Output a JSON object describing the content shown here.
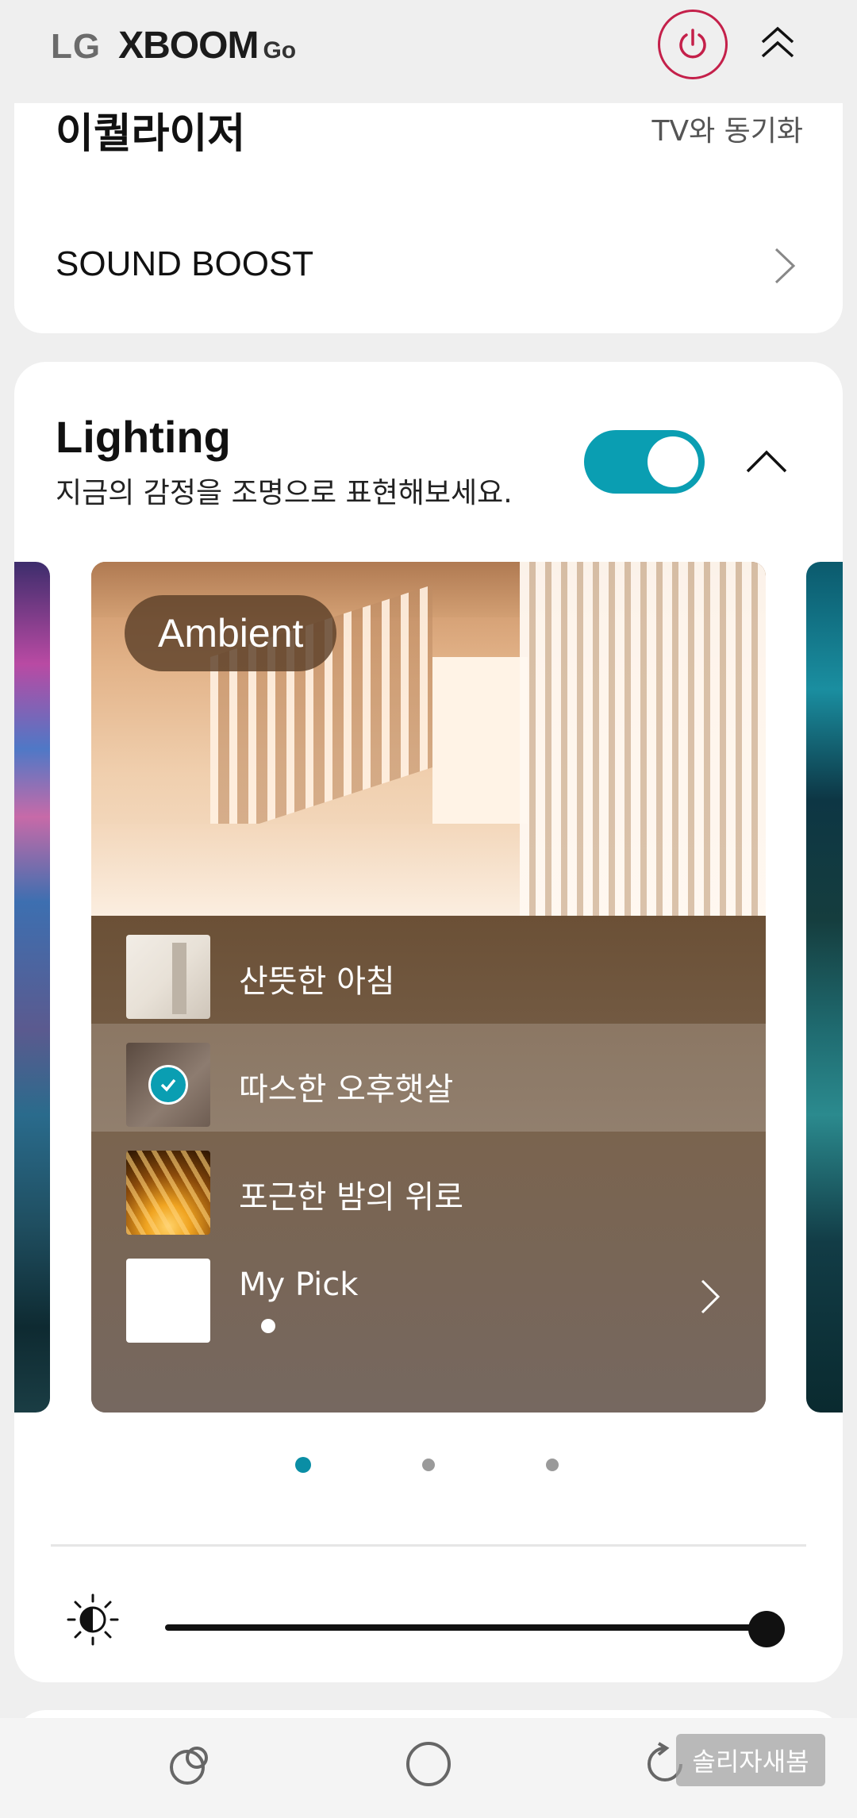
{
  "header": {
    "brand_lg": "LG",
    "brand_xboom": "XBOOM",
    "brand_go": "Go",
    "power_icon": "power-icon",
    "collapse_icon": "double-chevron-up-icon",
    "accent_color": "#c4204a"
  },
  "equalizer": {
    "title": "이퀄라이저",
    "tv_sync": "TV와 동기화",
    "sound_boost_label": "SOUND BOOST"
  },
  "lighting": {
    "title": "Lighting",
    "subtitle": "지금의 감정을 조명으로 표현해보세요.",
    "toggle_on": true,
    "toggle_color": "#0a9eb2",
    "mode_name": "Ambient",
    "items": [
      {
        "label": "산뜻한 아침",
        "selected": false
      },
      {
        "label": "따스한 오후햇살",
        "selected": true
      },
      {
        "label": "포근한 밤의 위로",
        "selected": false
      },
      {
        "label": "My Pick",
        "selected": false
      }
    ],
    "pager": {
      "count": 3,
      "active": 0
    },
    "brightness_level": 1.0
  },
  "navbar": {
    "toast": "솔리자새봄"
  }
}
